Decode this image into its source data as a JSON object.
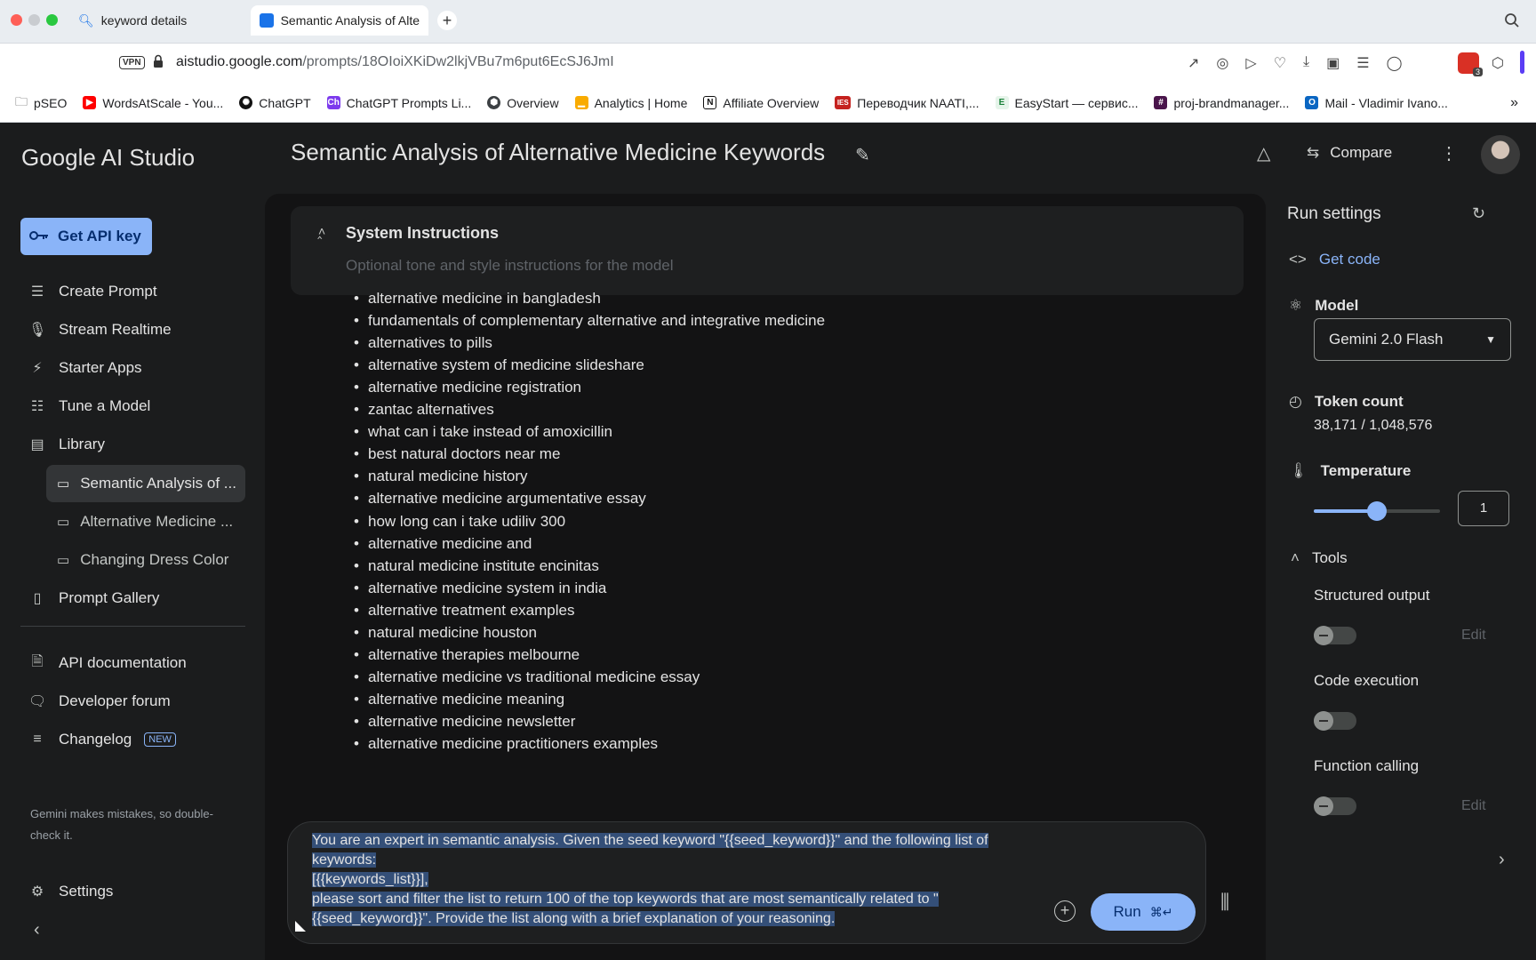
{
  "browser": {
    "tabs": [
      {
        "title": "keyword details"
      },
      {
        "title": "Semantic Analysis of Alte"
      }
    ],
    "url_host": "aistudio.google.com",
    "url_path": "/prompts/18OIoiXKiDw2lkjVBu7m6put6EcSJ6JmI",
    "vpn_label": "VPN",
    "extension_badge": "3",
    "bookmarks": [
      {
        "label": "pSEO",
        "icon": "folder-icon"
      },
      {
        "label": "WordsAtScale - You...",
        "icon": "youtube-icon"
      },
      {
        "label": "ChatGPT",
        "icon": "openai-icon"
      },
      {
        "label": "ChatGPT Prompts Li...",
        "icon": "ch-icon"
      },
      {
        "label": "Overview",
        "icon": "overview-icon"
      },
      {
        "label": "Analytics | Home",
        "icon": "analytics-icon"
      },
      {
        "label": "Affiliate Overview",
        "icon": "notion-icon"
      },
      {
        "label": "Переводчик NAATI,...",
        "icon": "ies-icon"
      },
      {
        "label": "EasyStart — сервис...",
        "icon": "easystart-icon"
      },
      {
        "label": "proj-brandmanager...",
        "icon": "slack-icon"
      },
      {
        "label": "Mail - Vladimir Ivano...",
        "icon": "outlook-icon"
      }
    ],
    "bookmarks_more": "»"
  },
  "sidebar": {
    "logo": "Google AI Studio",
    "api_key_button": "Get API key",
    "nav": [
      {
        "label": "Create Prompt",
        "icon": "create-prompt-icon"
      },
      {
        "label": "Stream Realtime",
        "icon": "microphone-icon"
      },
      {
        "label": "Starter Apps",
        "icon": "bolt-icon"
      },
      {
        "label": "Tune a Model",
        "icon": "tune-icon"
      },
      {
        "label": "Library",
        "icon": "library-icon"
      }
    ],
    "library_items": [
      {
        "label": "Semantic Analysis of ..."
      },
      {
        "label": "Alternative Medicine ..."
      },
      {
        "label": "Changing Dress Color"
      }
    ],
    "prompt_gallery": "Prompt Gallery",
    "links": [
      {
        "label": "API documentation"
      },
      {
        "label": "Developer forum"
      },
      {
        "label": "Changelog"
      }
    ],
    "new_badge": "NEW",
    "disclaimer": "Gemini makes mistakes, so double-check it.",
    "settings": "Settings"
  },
  "header": {
    "title": "Semantic Analysis of Alternative Medicine Keywords",
    "compare_label": "Compare"
  },
  "system_instructions": {
    "title": "System Instructions",
    "placeholder": "Optional tone and style instructions for the model"
  },
  "keywords": [
    "alternative medicine in bangladesh",
    "fundamentals of complementary alternative and integrative medicine",
    "alternatives to pills",
    "alternative system of medicine slideshare",
    "alternative medicine registration",
    "zantac alternatives",
    "what can i take instead of amoxicillin",
    "best natural doctors near me",
    "natural medicine history",
    "alternative medicine argumentative essay",
    "how long can i take udiliv 300",
    "alternative medicine and",
    "natural medicine institute encinitas",
    "alternative medicine system in india",
    "alternative treatment examples",
    "natural medicine houston",
    "alternative therapies melbourne",
    "alternative medicine vs traditional medicine essay",
    "alternative medicine meaning",
    "alternative medicine newsletter",
    "alternative medicine practitioners examples"
  ],
  "prompt_input": {
    "lines": [
      "You are an expert in semantic analysis. Given the seed keyword \"{{seed_keyword}}\" and the following list of",
      "keywords:",
      "[{{keywords_list}}],",
      "please sort and filter the list to return 100 of the top keywords that are most semantically related to \"",
      "{{seed_keyword}}\". Provide the list along with a brief explanation of your reasoning."
    ],
    "run_label": "Run",
    "run_shortcut": "⌘↵"
  },
  "run_settings": {
    "title": "Run settings",
    "get_code": "Get code",
    "model_label": "Model",
    "model_value": "Gemini 2.0 Flash",
    "token_label": "Token count",
    "token_value": "38,171 / 1,048,576",
    "temperature_label": "Temperature",
    "temperature_value": "1",
    "temperature_fraction": 0.5,
    "tools_label": "Tools",
    "structured_output": "Structured output",
    "code_execution": "Code execution",
    "function_calling": "Function calling",
    "edit_label": "Edit"
  },
  "colors": {
    "accent": "#8ab4f8",
    "app_bg": "#1b1c1d",
    "main_bg": "#131314",
    "selection": "#344f78"
  }
}
